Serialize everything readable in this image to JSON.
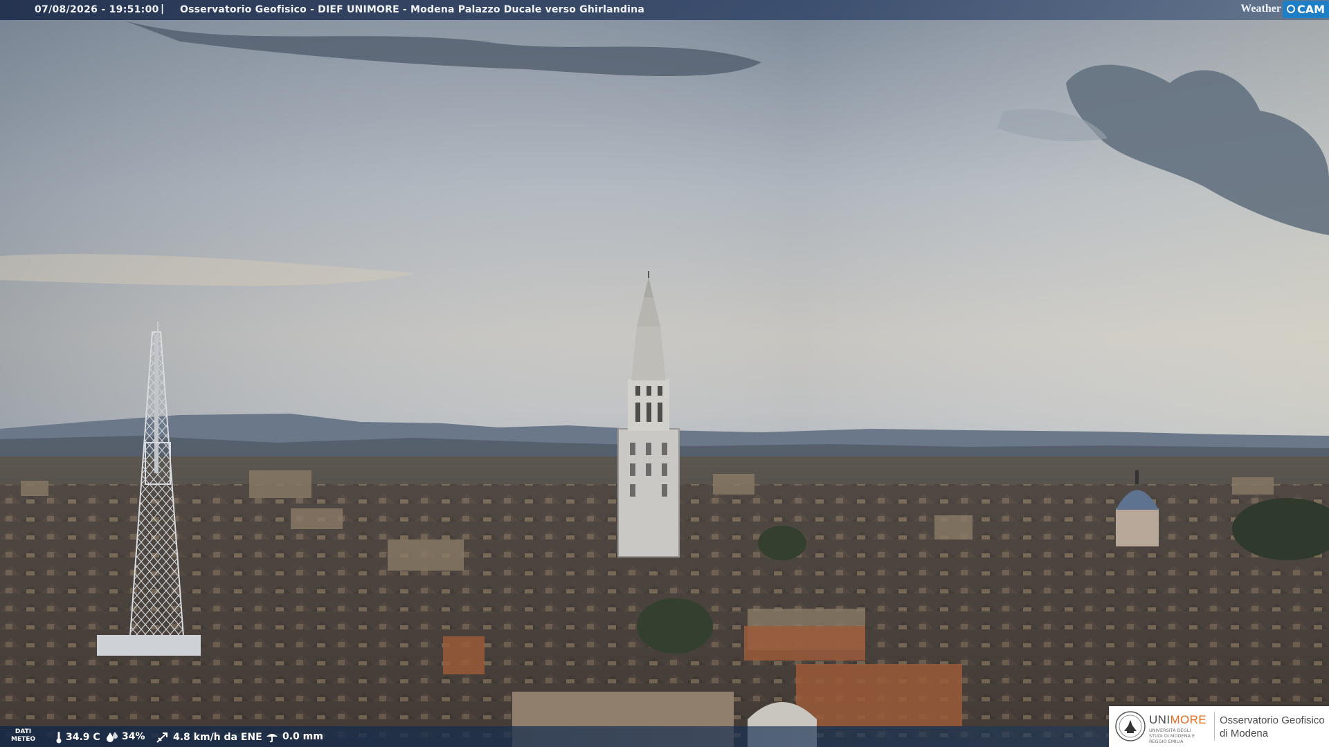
{
  "overlay": {
    "timestamp": "07/08/2026 - 19:51:00",
    "separator": "|",
    "title": "Osservatorio Geofisico - DIEF UNIMORE - Modena Palazzo Ducale verso Ghirlandina",
    "brand_word": "Weather",
    "brand_badge": "CAM"
  },
  "weather": {
    "label_line1": "DATI",
    "label_line2": "METEO",
    "temperature": "34.9 C",
    "humidity": "34%",
    "wind": "4.8 km/h da ENE",
    "rain": "0.0 mm"
  },
  "logo": {
    "uni_part1": "UNI",
    "uni_part2": "MORE",
    "university_subtitle": "UNIVERSITÀ DEGLI STUDI DI MODENA E REGGIO EMILIA",
    "observatory_line1": "Osservatorio Geofisico",
    "observatory_line2": "di Modena"
  },
  "colors": {
    "brand_blue": "#1e7fc7",
    "unimore_orange": "#e36d1e"
  }
}
